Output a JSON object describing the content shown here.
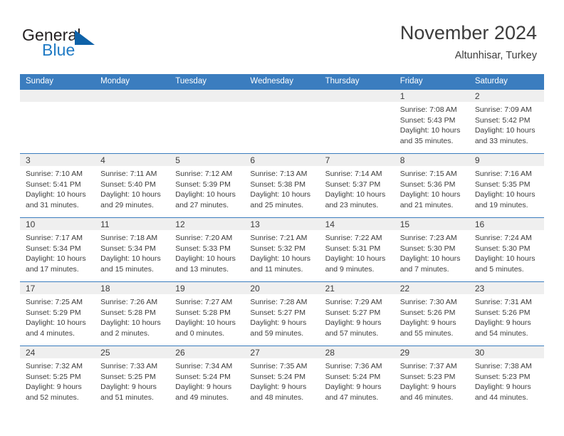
{
  "logo": {
    "text_top": "General",
    "text_bottom": "Blue",
    "color_top": "#231f20",
    "color_bottom": "#1f7ac4",
    "triangle_color": "#0f62a8"
  },
  "header": {
    "title": "November 2024",
    "subtitle": "Altunhisar, Turkey"
  },
  "colors": {
    "weekday_header_bg": "#3b7dbf",
    "day_band_bg": "#efefef",
    "text": "#3c3c3c",
    "row_divider": "#3b7dbf"
  },
  "weekdays": [
    "Sunday",
    "Monday",
    "Tuesday",
    "Wednesday",
    "Thursday",
    "Friday",
    "Saturday"
  ],
  "weeks": [
    [
      {
        "day": "",
        "empty": true
      },
      {
        "day": "",
        "empty": true
      },
      {
        "day": "",
        "empty": true
      },
      {
        "day": "",
        "empty": true
      },
      {
        "day": "",
        "empty": true
      },
      {
        "day": "1",
        "sunrise": "Sunrise: 7:08 AM",
        "sunset": "Sunset: 5:43 PM",
        "daylight": "Daylight: 10 hours and 35 minutes."
      },
      {
        "day": "2",
        "sunrise": "Sunrise: 7:09 AM",
        "sunset": "Sunset: 5:42 PM",
        "daylight": "Daylight: 10 hours and 33 minutes."
      }
    ],
    [
      {
        "day": "3",
        "sunrise": "Sunrise: 7:10 AM",
        "sunset": "Sunset: 5:41 PM",
        "daylight": "Daylight: 10 hours and 31 minutes."
      },
      {
        "day": "4",
        "sunrise": "Sunrise: 7:11 AM",
        "sunset": "Sunset: 5:40 PM",
        "daylight": "Daylight: 10 hours and 29 minutes."
      },
      {
        "day": "5",
        "sunrise": "Sunrise: 7:12 AM",
        "sunset": "Sunset: 5:39 PM",
        "daylight": "Daylight: 10 hours and 27 minutes."
      },
      {
        "day": "6",
        "sunrise": "Sunrise: 7:13 AM",
        "sunset": "Sunset: 5:38 PM",
        "daylight": "Daylight: 10 hours and 25 minutes."
      },
      {
        "day": "7",
        "sunrise": "Sunrise: 7:14 AM",
        "sunset": "Sunset: 5:37 PM",
        "daylight": "Daylight: 10 hours and 23 minutes."
      },
      {
        "day": "8",
        "sunrise": "Sunrise: 7:15 AM",
        "sunset": "Sunset: 5:36 PM",
        "daylight": "Daylight: 10 hours and 21 minutes."
      },
      {
        "day": "9",
        "sunrise": "Sunrise: 7:16 AM",
        "sunset": "Sunset: 5:35 PM",
        "daylight": "Daylight: 10 hours and 19 minutes."
      }
    ],
    [
      {
        "day": "10",
        "sunrise": "Sunrise: 7:17 AM",
        "sunset": "Sunset: 5:34 PM",
        "daylight": "Daylight: 10 hours and 17 minutes."
      },
      {
        "day": "11",
        "sunrise": "Sunrise: 7:18 AM",
        "sunset": "Sunset: 5:34 PM",
        "daylight": "Daylight: 10 hours and 15 minutes."
      },
      {
        "day": "12",
        "sunrise": "Sunrise: 7:20 AM",
        "sunset": "Sunset: 5:33 PM",
        "daylight": "Daylight: 10 hours and 13 minutes."
      },
      {
        "day": "13",
        "sunrise": "Sunrise: 7:21 AM",
        "sunset": "Sunset: 5:32 PM",
        "daylight": "Daylight: 10 hours and 11 minutes."
      },
      {
        "day": "14",
        "sunrise": "Sunrise: 7:22 AM",
        "sunset": "Sunset: 5:31 PM",
        "daylight": "Daylight: 10 hours and 9 minutes."
      },
      {
        "day": "15",
        "sunrise": "Sunrise: 7:23 AM",
        "sunset": "Sunset: 5:30 PM",
        "daylight": "Daylight: 10 hours and 7 minutes."
      },
      {
        "day": "16",
        "sunrise": "Sunrise: 7:24 AM",
        "sunset": "Sunset: 5:30 PM",
        "daylight": "Daylight: 10 hours and 5 minutes."
      }
    ],
    [
      {
        "day": "17",
        "sunrise": "Sunrise: 7:25 AM",
        "sunset": "Sunset: 5:29 PM",
        "daylight": "Daylight: 10 hours and 4 minutes."
      },
      {
        "day": "18",
        "sunrise": "Sunrise: 7:26 AM",
        "sunset": "Sunset: 5:28 PM",
        "daylight": "Daylight: 10 hours and 2 minutes."
      },
      {
        "day": "19",
        "sunrise": "Sunrise: 7:27 AM",
        "sunset": "Sunset: 5:28 PM",
        "daylight": "Daylight: 10 hours and 0 minutes."
      },
      {
        "day": "20",
        "sunrise": "Sunrise: 7:28 AM",
        "sunset": "Sunset: 5:27 PM",
        "daylight": "Daylight: 9 hours and 59 minutes."
      },
      {
        "day": "21",
        "sunrise": "Sunrise: 7:29 AM",
        "sunset": "Sunset: 5:27 PM",
        "daylight": "Daylight: 9 hours and 57 minutes."
      },
      {
        "day": "22",
        "sunrise": "Sunrise: 7:30 AM",
        "sunset": "Sunset: 5:26 PM",
        "daylight": "Daylight: 9 hours and 55 minutes."
      },
      {
        "day": "23",
        "sunrise": "Sunrise: 7:31 AM",
        "sunset": "Sunset: 5:26 PM",
        "daylight": "Daylight: 9 hours and 54 minutes."
      }
    ],
    [
      {
        "day": "24",
        "sunrise": "Sunrise: 7:32 AM",
        "sunset": "Sunset: 5:25 PM",
        "daylight": "Daylight: 9 hours and 52 minutes."
      },
      {
        "day": "25",
        "sunrise": "Sunrise: 7:33 AM",
        "sunset": "Sunset: 5:25 PM",
        "daylight": "Daylight: 9 hours and 51 minutes."
      },
      {
        "day": "26",
        "sunrise": "Sunrise: 7:34 AM",
        "sunset": "Sunset: 5:24 PM",
        "daylight": "Daylight: 9 hours and 49 minutes."
      },
      {
        "day": "27",
        "sunrise": "Sunrise: 7:35 AM",
        "sunset": "Sunset: 5:24 PM",
        "daylight": "Daylight: 9 hours and 48 minutes."
      },
      {
        "day": "28",
        "sunrise": "Sunrise: 7:36 AM",
        "sunset": "Sunset: 5:24 PM",
        "daylight": "Daylight: 9 hours and 47 minutes."
      },
      {
        "day": "29",
        "sunrise": "Sunrise: 7:37 AM",
        "sunset": "Sunset: 5:23 PM",
        "daylight": "Daylight: 9 hours and 46 minutes."
      },
      {
        "day": "30",
        "sunrise": "Sunrise: 7:38 AM",
        "sunset": "Sunset: 5:23 PM",
        "daylight": "Daylight: 9 hours and 44 minutes."
      }
    ]
  ]
}
